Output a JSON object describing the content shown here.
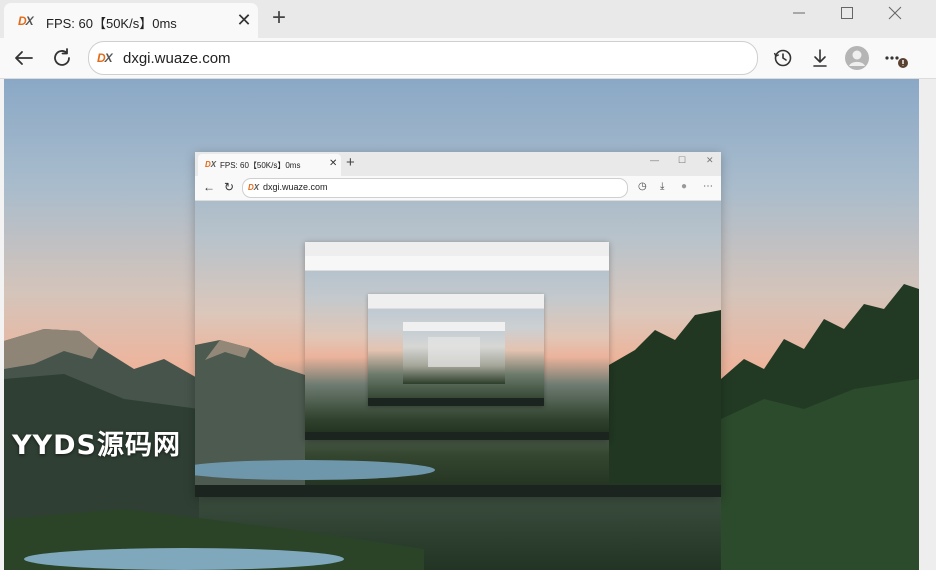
{
  "tab": {
    "title": "FPS: 60【50K/s】0ms",
    "close": "✕",
    "new_tab": "+"
  },
  "window": {
    "minimize": "—",
    "maximize": "☐",
    "close": "✕"
  },
  "nav": {
    "back": "←",
    "reload": "↻"
  },
  "omnibox": {
    "url": "dxgi.wuaze.com"
  },
  "favicon": {
    "d": "D",
    "x": "X"
  },
  "inner_window": {
    "tab_title": "FPS: 60【50K/s】0ms",
    "url": "dxgi.wuaze.com",
    "close": "✕",
    "new_tab": "+"
  },
  "watermark": {
    "text": "YYDS源码网"
  },
  "colors": {
    "accent": "#e46a18",
    "chrome": "#f9f9f9",
    "tabstrip": "#e9e9e9"
  },
  "icons": [
    "dx-favicon",
    "close-icon",
    "plus-icon",
    "minimize-icon",
    "maximize-icon",
    "back-icon",
    "reload-icon",
    "history-icon",
    "download-icon",
    "profile-icon",
    "more-icon",
    "notification-badge"
  ]
}
